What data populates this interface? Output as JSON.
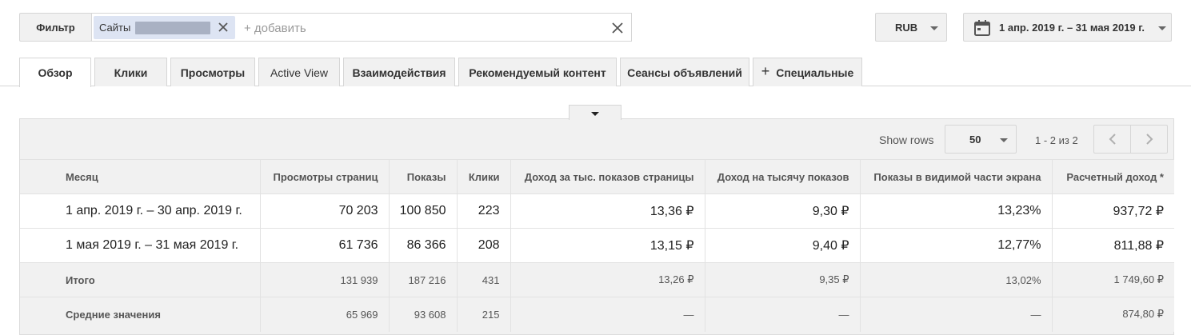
{
  "toolbar": {
    "filter_label": "Фильтр",
    "chip_label": "Сайты",
    "add_placeholder": "+ добавить",
    "currency": "RUB",
    "date_range": "1 апр. 2019 г. – 31 мая 2019 г."
  },
  "tabs": [
    {
      "label": "Обзор",
      "active": true
    },
    {
      "label": "Клики"
    },
    {
      "label": "Просмотры"
    },
    {
      "label": "Active View"
    },
    {
      "label": "Взаимодействия"
    },
    {
      "label": "Рекомендуемый контент"
    },
    {
      "label": "Сеансы объявлений"
    },
    {
      "label": "Специальные",
      "icon": "plus-icon"
    }
  ],
  "pagination": {
    "show_rows_label": "Show rows",
    "rows_value": "50",
    "range_text": "1 - 2 из 2"
  },
  "table": {
    "headers": [
      "Месяц",
      "Просмотры страниц",
      "Показы",
      "Клики",
      "Доход за тыс. показов страницы",
      "Доход на тысячу показов",
      "Показы в видимой части экрана",
      "Расчетный доход *"
    ],
    "rows": [
      [
        "1 апр. 2019 г. – 30 апр. 2019 г.",
        "70 203",
        "100 850",
        "223",
        "13,36 ₽",
        "9,30 ₽",
        "13,23%",
        "937,72 ₽"
      ],
      [
        "1 мая 2019 г. – 31 мая 2019 г.",
        "61 736",
        "86 366",
        "208",
        "13,15 ₽",
        "9,40 ₽",
        "12,77%",
        "811,88 ₽"
      ]
    ],
    "total": [
      "Итого",
      "131 939",
      "187 216",
      "431",
      "13,26 ₽",
      "9,35 ₽",
      "13,02%",
      "1 749,60 ₽"
    ],
    "average": [
      "Средние значения",
      "65 969",
      "93 608",
      "215",
      "—",
      "—",
      "—",
      "874,80 ₽"
    ]
  }
}
